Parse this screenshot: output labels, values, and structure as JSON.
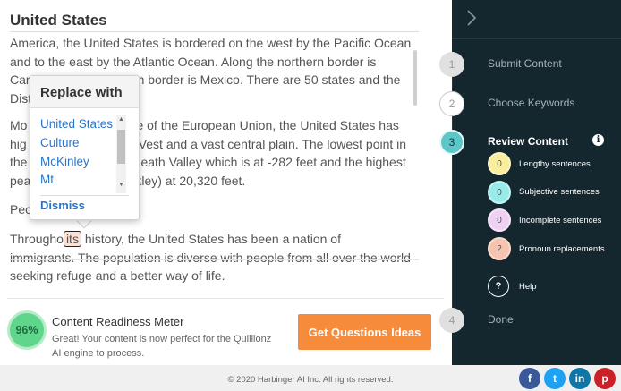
{
  "document": {
    "title": "United States",
    "p1_line1": "America, the United States is bordered on the west by the Pacific Ocean",
    "p1_line2": "and to the east by the Atlantic Ocean. Along the northern border is",
    "p1_line3a": "Car",
    "p1_line3b": "n border is Mexico. There are 50 states and the",
    "p1_line4": "Dist",
    "p2_line1a": "Mo",
    "p2_line1b": "e of the European Union, the United States has",
    "p2_line2a": "hig",
    "p2_line2b": "Vest and a vast central plain. The lowest point in",
    "p2_line3a": "the",
    "p2_line3b": "eath Valley which is at -282 feet and the highest",
    "p2_line4a": "pea",
    "p2_line4b": "kley) at 20,320 feet.",
    "p3": "Peo",
    "p4_before": "Througho",
    "p4_flagged": "its",
    "p4_after": "history, the United States has been a nation of",
    "p4_line2": "immigrants. The population is diverse with people from all over the world",
    "p4_line3": "seeking refuge and a better way of life."
  },
  "popup": {
    "title": "Replace with",
    "options": [
      "United States",
      "Culture",
      "McKinley",
      "Mt."
    ],
    "dismiss": "Dismiss"
  },
  "meter": {
    "value": "96%",
    "title": "Content Readiness Meter",
    "message": "Great! Your content is now perfect for the Quillionz AI engine to process."
  },
  "cta": {
    "label": "Get Questions Ideas"
  },
  "footer": {
    "copyright": "© 2020 Harbinger AI Inc. All rights reserved.",
    "social": [
      "f",
      "t",
      "in",
      "p"
    ]
  },
  "sidebar": {
    "steps": [
      {
        "number": "1",
        "label": "Submit Content"
      },
      {
        "number": "2",
        "label": "Choose Keywords"
      },
      {
        "number": "3",
        "label": "Review Content"
      },
      {
        "number": "4",
        "label": "Done"
      }
    ],
    "review_items": [
      {
        "count": "0",
        "label": "Lengthy sentences",
        "color": "#f8ee9c"
      },
      {
        "count": "0",
        "label": "Subjective sentences",
        "color": "#97ece9"
      },
      {
        "count": "0",
        "label": "Incomplete sentences",
        "color": "#efd2f3"
      },
      {
        "count": "2",
        "label": "Pronoun replacements",
        "color": "#f6c3b1"
      }
    ],
    "help": {
      "icon": "?",
      "label": "Help"
    },
    "info_icon": "i"
  },
  "colors": {
    "sidebar_bg": "#14272f",
    "accent_teal": "#5cc7c9",
    "cta_orange": "#f68b3b",
    "link_blue": "#2a74c9",
    "meter_green": "#5fd68b"
  }
}
